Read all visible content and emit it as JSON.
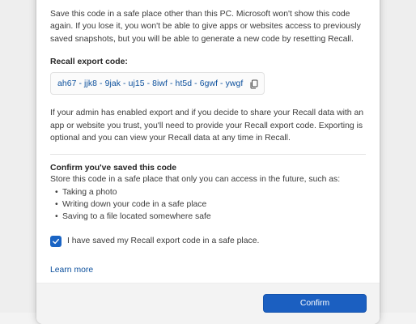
{
  "dialog": {
    "intro_text": "Save this code in a safe place other than this PC. Microsoft won't show this code again. If you lose it, you won't be able to give apps or websites access to previously saved snapshots, but you will be able to generate a new code by resetting Recall.",
    "code_label": "Recall export code:",
    "export_code": "ah67 - jjk8 - 9jak - uj15 - 8iwf - ht5d - 6gwf - ywgf",
    "copy_icon": "copy-icon",
    "export_info": "If your admin has enabled export and if you decide to share your Recall data with an app or website you trust, you'll need to provide your Recall export code. Exporting is optional and you can view your Recall data at any time in Recall.",
    "confirm_heading": "Confirm you've saved this code",
    "confirm_desc": "Store this code in a safe place that only you can access in the future, such as:",
    "bullets": [
      "Taking a photo",
      "Writing down your code in a safe place",
      "Saving to a file located somewhere safe"
    ],
    "checkbox_label": "I have saved my Recall export code in a safe place.",
    "checkbox_checked": true,
    "learn_more": "Learn more",
    "confirm_button": "Confirm",
    "accent_color": "#1b5fc1"
  }
}
